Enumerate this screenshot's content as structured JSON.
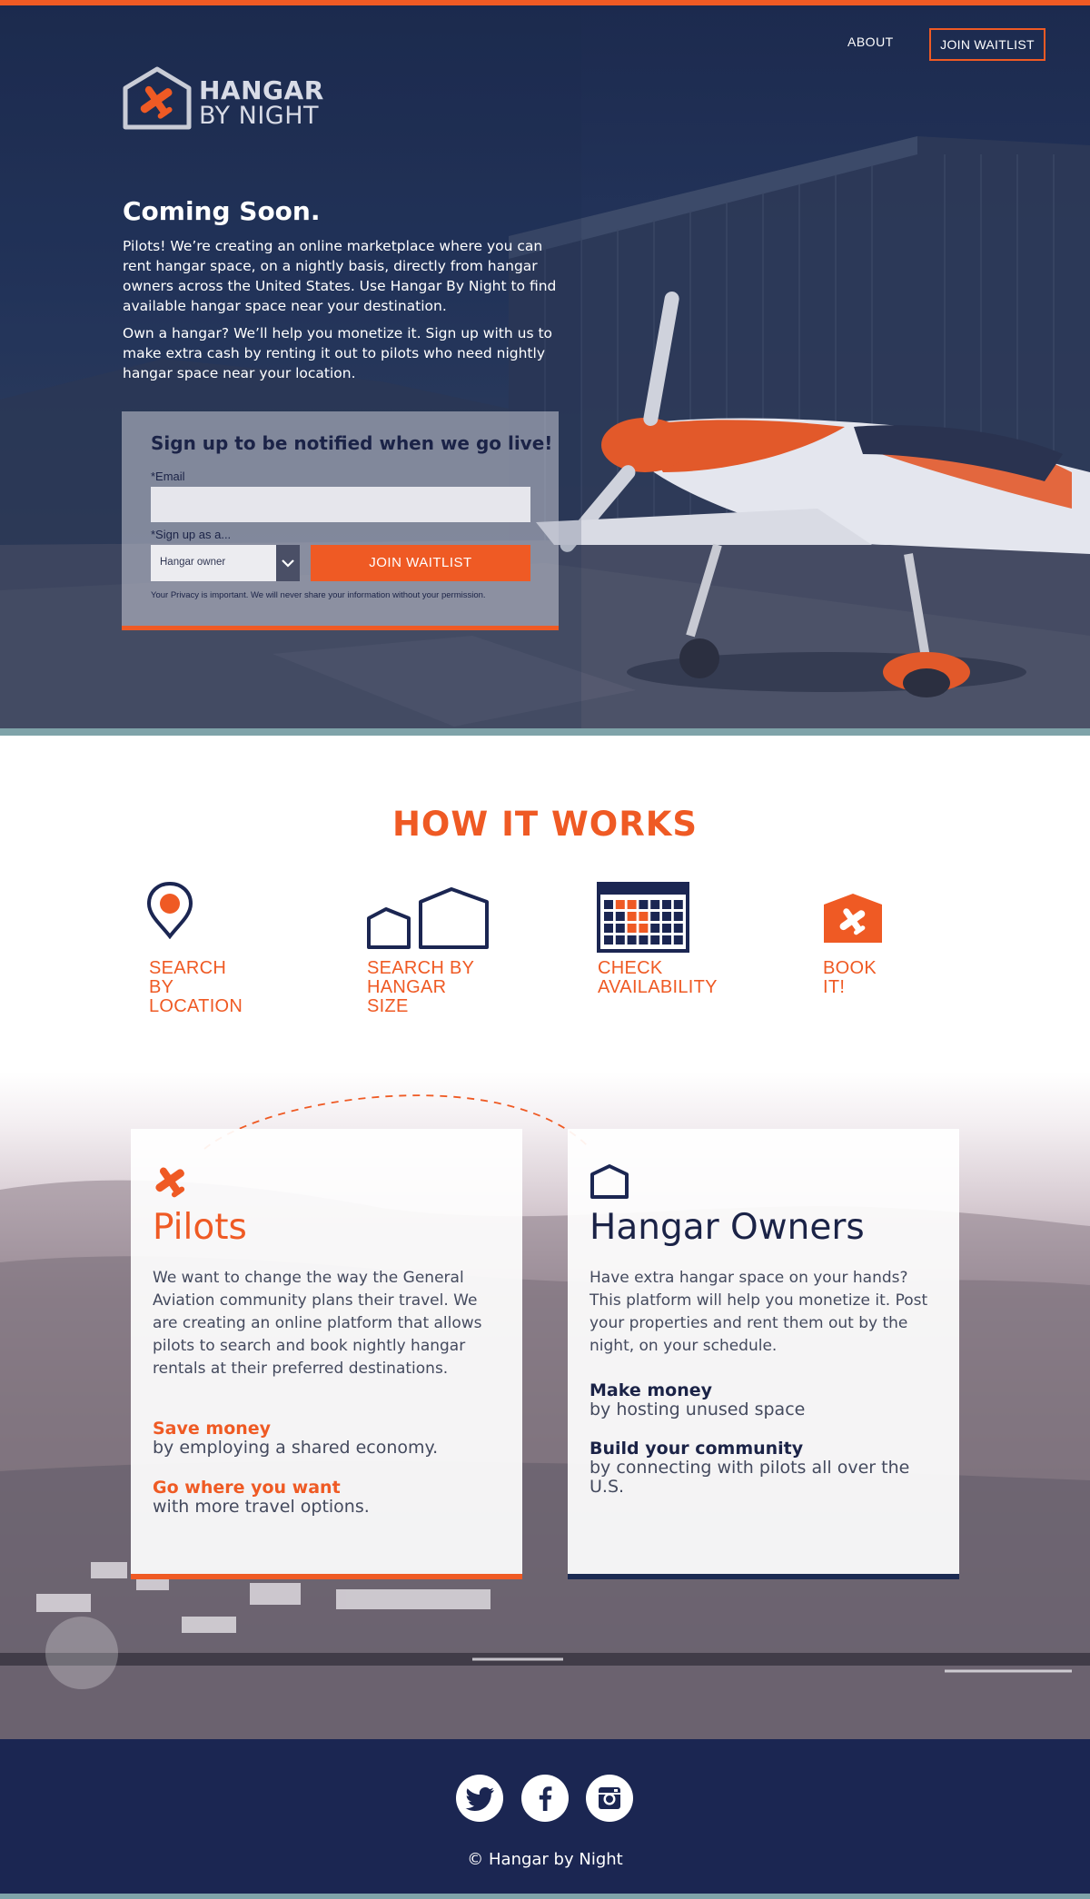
{
  "nav": {
    "about": "ABOUT",
    "join_waitlist": "JOIN WAITLIST"
  },
  "logo": {
    "line1": "HANGAR",
    "line2": "BY NIGHT",
    "icon": "plane-house-icon"
  },
  "hero": {
    "title": "Coming Soon.",
    "paragraph1": "Pilots! We’re creating an online marketplace where you can rent hangar space, on a nightly basis, directly from hangar owners across the United States. Use Hangar By Night to find available hangar space near your destination.",
    "paragraph2": "Own a hangar? We’ll help you monetize it. Sign up with us to make extra cash by renting it out to pilots who need nightly hangar space near your location."
  },
  "signup": {
    "title": "Sign up to be notified when we go live!",
    "email_label": "*Email",
    "email_value": "",
    "role_label": "*Sign up as a...",
    "role_value": "Hangar owner",
    "button": "JOIN WAITLIST",
    "privacy": "Your Privacy is important. We will never share your information without your permission."
  },
  "how_it_works": {
    "title": "HOW IT WORKS",
    "steps": [
      {
        "line1": "SEARCH BY",
        "line2": "LOCATION",
        "icon": "map-pin-icon"
      },
      {
        "line1": "SEARCH BY",
        "line2": "HANGAR SIZE",
        "icon": "hangar-size-icon"
      },
      {
        "line1": "CHECK",
        "line2": "AVAILABILITY",
        "icon": "calendar-icon"
      },
      {
        "line1": "BOOK IT!",
        "line2": "",
        "icon": "plane-badge-icon"
      }
    ]
  },
  "pilots": {
    "title": "Pilots",
    "icon": "plane-icon",
    "description": "We want to change the way the General Aviation community plans their travel. We are creating an online platform that allows pilots to search and book nightly hangar rentals at their preferred destinations.",
    "benefits": [
      {
        "title": "Save money",
        "sub": "by employing a shared economy."
      },
      {
        "title": "Go where you want",
        "sub": "with more travel options."
      }
    ]
  },
  "owners": {
    "title": "Hangar Owners",
    "icon": "hangar-icon",
    "description": "Have extra hangar space on your hands? This platform will help you monetize it. Post your properties and rent them out by the night, on your schedule.",
    "benefits": [
      {
        "title": "Make money",
        "sub": "by hosting unused space"
      },
      {
        "title": "Build your community",
        "sub": "by connecting with pilots all over the U.S."
      }
    ]
  },
  "footer": {
    "copyright": "© Hangar by Night",
    "social": [
      "twitter-icon",
      "facebook-icon",
      "instagram-icon"
    ]
  },
  "colors": {
    "accent": "#ef5a24",
    "navy": "#1b2347",
    "teal": "#7fa3a9"
  }
}
